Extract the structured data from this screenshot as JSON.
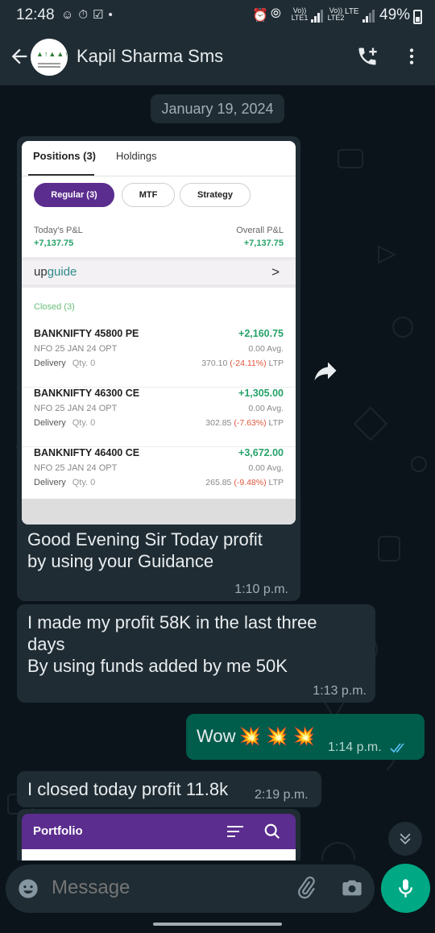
{
  "status_bar": {
    "time": "12:48",
    "battery": "49%",
    "sim1_label": "Vo)) LTE1",
    "sim2_label": "Vo)) LTE2",
    "sim2_network": "LTE"
  },
  "header": {
    "contact_name": "Kapil Sharma Sms"
  },
  "chat": {
    "date_chip": "January 19, 2024",
    "messages": [
      {
        "direction": "in",
        "text_lines": [
          "Good Evening Sir Today profit",
          "by using your Guidance"
        ],
        "time": "1:10 p.m."
      },
      {
        "direction": "in",
        "text_lines": [
          "I made my profit 58K in the last three",
          "days",
          "By using funds added by me 50K"
        ],
        "time": "1:13 p.m."
      },
      {
        "direction": "out",
        "text": "Wow",
        "emoji": "💥 💥 💥",
        "time": "1:14 p.m.",
        "status": "read"
      },
      {
        "direction": "in",
        "text": "I closed today profit 11.8k",
        "time": "2:19 p.m."
      }
    ]
  },
  "screenshot_card": {
    "tabs": [
      "Positions (3)",
      "Holdings"
    ],
    "filters": [
      "Regular (3)",
      "MTF",
      "Strategy"
    ],
    "todays_pl_label": "Today's P&L",
    "todays_pl_value": "+7,137.75",
    "overall_pl_label": "Overall P&L",
    "overall_pl_value": "+7,137.75",
    "upguide_prefix": "up",
    "upguide_suffix": "guide",
    "upguide_chevron": ">",
    "closed_label": "Closed (3)",
    "positions": [
      {
        "name": "BANKNIFTY 45800 PE",
        "pnl": "+2,160.75",
        "instrument": "NFO 25 JAN 24 OPT",
        "avg": "0.00 Avg.",
        "product": "Delivery",
        "qty": "Qty. 0",
        "ltp_price": "370.10",
        "ltp_change": "(-24.11%)",
        "ltp_suffix": "LTP"
      },
      {
        "name": "BANKNIFTY 46300 CE",
        "pnl": "+1,305.00",
        "instrument": "NFO 25 JAN 24 OPT",
        "avg": "0.00 Avg.",
        "product": "Delivery",
        "qty": "Qty. 0",
        "ltp_price": "302.85",
        "ltp_change": "(-7.63%)",
        "ltp_suffix": "LTP"
      },
      {
        "name": "BANKNIFTY 46400 CE",
        "pnl": "+3,672.00",
        "instrument": "NFO 25 JAN 24 OPT",
        "avg": "0.00 Avg.",
        "product": "Delivery",
        "qty": "Qty. 0",
        "ltp_price": "265.85",
        "ltp_change": "(-9.48%)",
        "ltp_suffix": "LTP"
      }
    ]
  },
  "portfolio_card": {
    "title": "Portfolio"
  },
  "composer": {
    "placeholder": "Message"
  },
  "colors": {
    "header_bg": "#1f2c34",
    "incoming_bubble": "#1f2c34",
    "outgoing_bubble": "#005c4b",
    "accent_green": "#00a884",
    "positive_pnl": "#26a269",
    "negative_change": "#e0553b",
    "broker_purple": "#5b2d8e",
    "read_tick": "#53bdeb"
  },
  "icons": {
    "back": "back-arrow-icon",
    "add_call": "add-call-icon",
    "menu": "more-vert-icon",
    "forward": "forward-icon",
    "emoji": "emoji-icon",
    "attach": "attach-icon",
    "camera": "camera-icon",
    "mic": "mic-icon",
    "scroll_down": "chevron-double-down-icon"
  }
}
